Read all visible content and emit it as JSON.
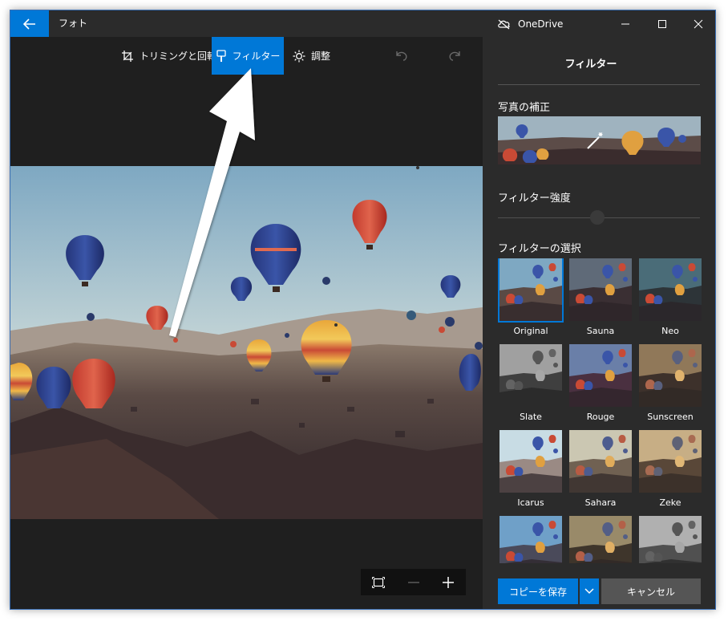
{
  "titlebar": {
    "app_title": "フォト",
    "onedrive_label": "OneDrive",
    "back_icon": "back-arrow-icon"
  },
  "toolbar": {
    "crop_label": "トリミングと回転",
    "filter_label": "フィルター",
    "adjust_label": "調整",
    "active_tool": "filter"
  },
  "panel": {
    "title": "フィルター",
    "enhance_label": "写真の補正",
    "intensity_label": "フィルター強度",
    "intensity_value": 50,
    "select_label": "フィルターの選択",
    "filters": [
      {
        "name": "Original",
        "selected": true
      },
      {
        "name": "Sauna",
        "selected": false
      },
      {
        "name": "Neo",
        "selected": false
      },
      {
        "name": "Slate",
        "selected": false
      },
      {
        "name": "Rouge",
        "selected": false
      },
      {
        "name": "Sunscreen",
        "selected": false
      },
      {
        "name": "Icarus",
        "selected": false
      },
      {
        "name": "Sahara",
        "selected": false
      },
      {
        "name": "Zeke",
        "selected": false
      },
      {
        "name": "",
        "selected": false
      },
      {
        "name": "",
        "selected": false
      },
      {
        "name": "",
        "selected": false
      }
    ]
  },
  "footer": {
    "save_copy_label": "コピーを保存",
    "cancel_label": "キャンセル"
  },
  "colors": {
    "accent": "#0078d7",
    "window_bg": "#1f1f1f",
    "panel_bg": "#2b2b2b"
  }
}
